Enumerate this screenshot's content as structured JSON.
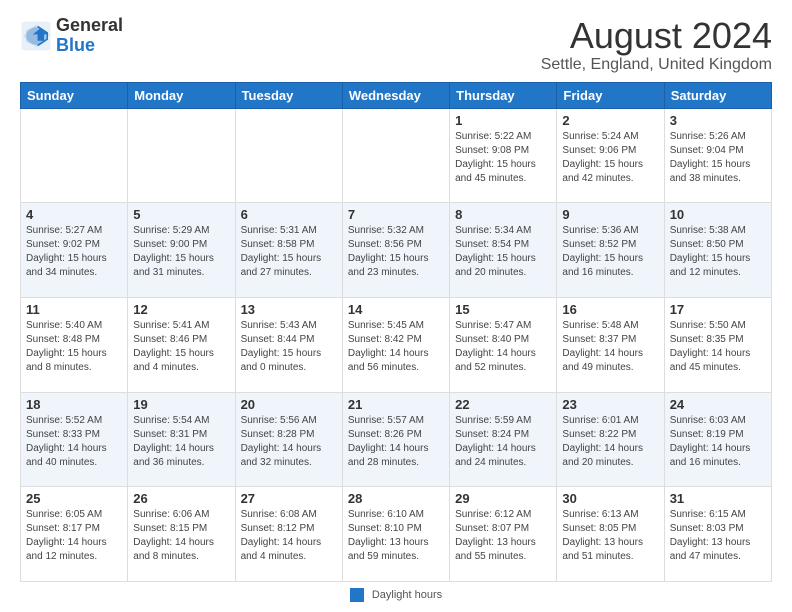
{
  "header": {
    "logo_line1": "General",
    "logo_line2": "Blue",
    "title": "August 2024",
    "subtitle": "Settle, England, United Kingdom"
  },
  "footer": {
    "daylight_label": "Daylight hours"
  },
  "days_of_week": [
    "Sunday",
    "Monday",
    "Tuesday",
    "Wednesday",
    "Thursday",
    "Friday",
    "Saturday"
  ],
  "weeks": [
    [
      {
        "day": "",
        "info": ""
      },
      {
        "day": "",
        "info": ""
      },
      {
        "day": "",
        "info": ""
      },
      {
        "day": "",
        "info": ""
      },
      {
        "day": "1",
        "info": "Sunrise: 5:22 AM\nSunset: 9:08 PM\nDaylight: 15 hours\nand 45 minutes."
      },
      {
        "day": "2",
        "info": "Sunrise: 5:24 AM\nSunset: 9:06 PM\nDaylight: 15 hours\nand 42 minutes."
      },
      {
        "day": "3",
        "info": "Sunrise: 5:26 AM\nSunset: 9:04 PM\nDaylight: 15 hours\nand 38 minutes."
      }
    ],
    [
      {
        "day": "4",
        "info": "Sunrise: 5:27 AM\nSunset: 9:02 PM\nDaylight: 15 hours\nand 34 minutes."
      },
      {
        "day": "5",
        "info": "Sunrise: 5:29 AM\nSunset: 9:00 PM\nDaylight: 15 hours\nand 31 minutes."
      },
      {
        "day": "6",
        "info": "Sunrise: 5:31 AM\nSunset: 8:58 PM\nDaylight: 15 hours\nand 27 minutes."
      },
      {
        "day": "7",
        "info": "Sunrise: 5:32 AM\nSunset: 8:56 PM\nDaylight: 15 hours\nand 23 minutes."
      },
      {
        "day": "8",
        "info": "Sunrise: 5:34 AM\nSunset: 8:54 PM\nDaylight: 15 hours\nand 20 minutes."
      },
      {
        "day": "9",
        "info": "Sunrise: 5:36 AM\nSunset: 8:52 PM\nDaylight: 15 hours\nand 16 minutes."
      },
      {
        "day": "10",
        "info": "Sunrise: 5:38 AM\nSunset: 8:50 PM\nDaylight: 15 hours\nand 12 minutes."
      }
    ],
    [
      {
        "day": "11",
        "info": "Sunrise: 5:40 AM\nSunset: 8:48 PM\nDaylight: 15 hours\nand 8 minutes."
      },
      {
        "day": "12",
        "info": "Sunrise: 5:41 AM\nSunset: 8:46 PM\nDaylight: 15 hours\nand 4 minutes."
      },
      {
        "day": "13",
        "info": "Sunrise: 5:43 AM\nSunset: 8:44 PM\nDaylight: 15 hours\nand 0 minutes."
      },
      {
        "day": "14",
        "info": "Sunrise: 5:45 AM\nSunset: 8:42 PM\nDaylight: 14 hours\nand 56 minutes."
      },
      {
        "day": "15",
        "info": "Sunrise: 5:47 AM\nSunset: 8:40 PM\nDaylight: 14 hours\nand 52 minutes."
      },
      {
        "day": "16",
        "info": "Sunrise: 5:48 AM\nSunset: 8:37 PM\nDaylight: 14 hours\nand 49 minutes."
      },
      {
        "day": "17",
        "info": "Sunrise: 5:50 AM\nSunset: 8:35 PM\nDaylight: 14 hours\nand 45 minutes."
      }
    ],
    [
      {
        "day": "18",
        "info": "Sunrise: 5:52 AM\nSunset: 8:33 PM\nDaylight: 14 hours\nand 40 minutes."
      },
      {
        "day": "19",
        "info": "Sunrise: 5:54 AM\nSunset: 8:31 PM\nDaylight: 14 hours\nand 36 minutes."
      },
      {
        "day": "20",
        "info": "Sunrise: 5:56 AM\nSunset: 8:28 PM\nDaylight: 14 hours\nand 32 minutes."
      },
      {
        "day": "21",
        "info": "Sunrise: 5:57 AM\nSunset: 8:26 PM\nDaylight: 14 hours\nand 28 minutes."
      },
      {
        "day": "22",
        "info": "Sunrise: 5:59 AM\nSunset: 8:24 PM\nDaylight: 14 hours\nand 24 minutes."
      },
      {
        "day": "23",
        "info": "Sunrise: 6:01 AM\nSunset: 8:22 PM\nDaylight: 14 hours\nand 20 minutes."
      },
      {
        "day": "24",
        "info": "Sunrise: 6:03 AM\nSunset: 8:19 PM\nDaylight: 14 hours\nand 16 minutes."
      }
    ],
    [
      {
        "day": "25",
        "info": "Sunrise: 6:05 AM\nSunset: 8:17 PM\nDaylight: 14 hours\nand 12 minutes."
      },
      {
        "day": "26",
        "info": "Sunrise: 6:06 AM\nSunset: 8:15 PM\nDaylight: 14 hours\nand 8 minutes."
      },
      {
        "day": "27",
        "info": "Sunrise: 6:08 AM\nSunset: 8:12 PM\nDaylight: 14 hours\nand 4 minutes."
      },
      {
        "day": "28",
        "info": "Sunrise: 6:10 AM\nSunset: 8:10 PM\nDaylight: 13 hours\nand 59 minutes."
      },
      {
        "day": "29",
        "info": "Sunrise: 6:12 AM\nSunset: 8:07 PM\nDaylight: 13 hours\nand 55 minutes."
      },
      {
        "day": "30",
        "info": "Sunrise: 6:13 AM\nSunset: 8:05 PM\nDaylight: 13 hours\nand 51 minutes."
      },
      {
        "day": "31",
        "info": "Sunrise: 6:15 AM\nSunset: 8:03 PM\nDaylight: 13 hours\nand 47 minutes."
      }
    ]
  ]
}
